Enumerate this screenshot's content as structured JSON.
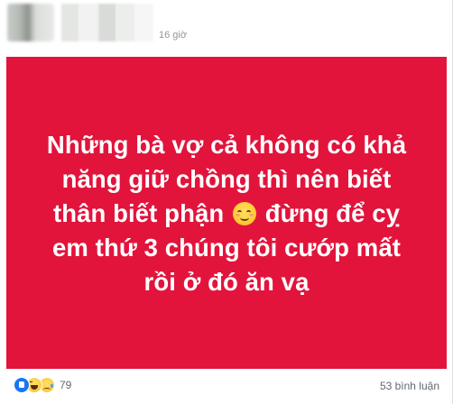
{
  "post": {
    "timestamp": "16 giờ",
    "banner": {
      "background_color": "#e2143c",
      "text_color": "#ffffff",
      "line_1": "Những bà vợ cả không có khả",
      "line_2": "năng giữ chồng thì nên biết",
      "line_3_before_emoji": "thân biết phận",
      "emoji": "smiling-face-with-smiling-eyes-icon",
      "line_3_after_emoji": "đừng để cỵ",
      "line_4": "em thứ 3 chúng tôi cướp mất",
      "line_5": "rồi ở đó ăn vạ"
    },
    "footer": {
      "reaction_icons": [
        "like-reaction-icon",
        "haha-reaction-icon",
        "sad-reaction-icon"
      ],
      "reaction_count": "79",
      "comment_count": "53 bình luận"
    }
  },
  "colors": {
    "accent_blue": "#1877f2",
    "muted_text": "#606770",
    "timestamp_text": "#90949c"
  }
}
